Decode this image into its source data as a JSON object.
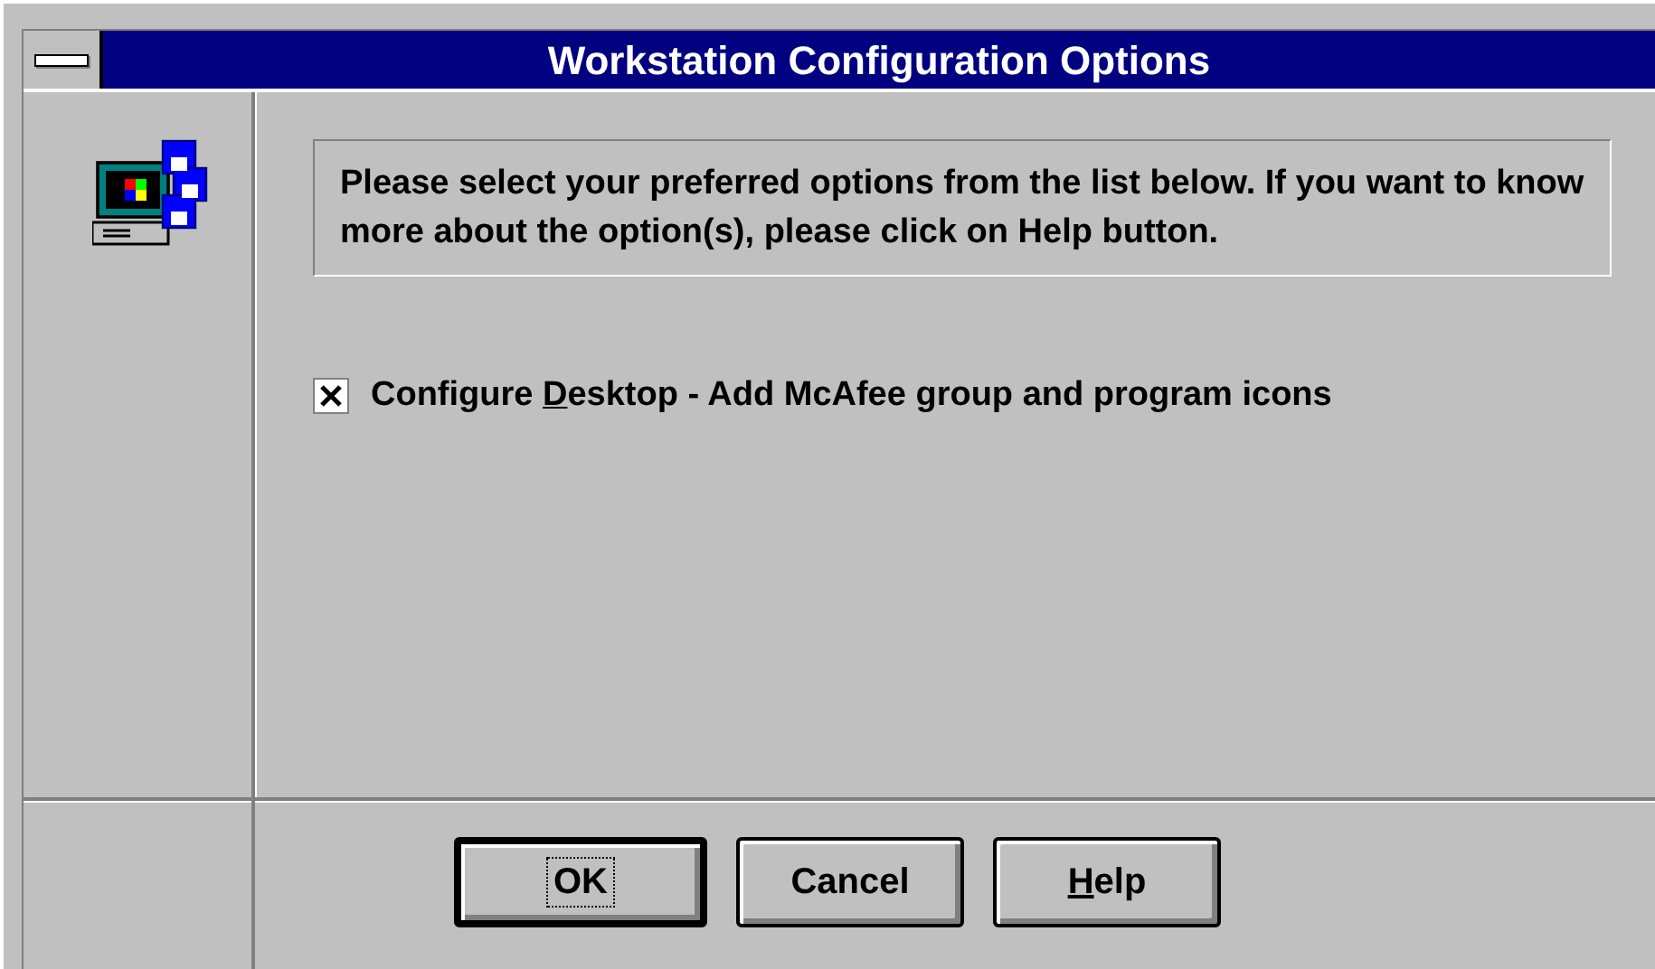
{
  "window": {
    "title": "Workstation Configuration Options"
  },
  "instructions": "Please select your preferred options from the list below.  If you want to know more about the option(s), please click on Help button.",
  "options": [
    {
      "kind": "checkbox",
      "label": {
        "before": "Configure ",
        "key": "D",
        "after": "esktop - Add McAfee group and program icons"
      },
      "checked": true
    }
  ],
  "buttons": [
    {
      "label": {
        "after": "OK"
      },
      "default": true,
      "focused": true
    },
    {
      "label": {
        "after": "Cancel"
      },
      "default": false,
      "focused": false
    },
    {
      "label": {
        "key": "H",
        "after": "elp"
      },
      "default": false,
      "focused": false
    }
  ]
}
